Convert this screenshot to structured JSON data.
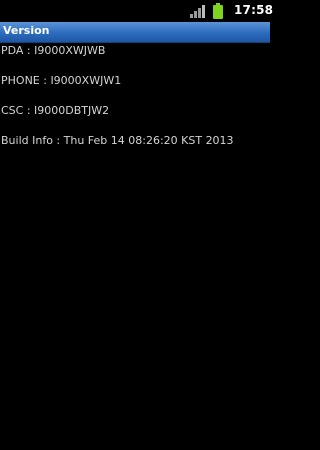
{
  "status_bar": {
    "time": "17:58",
    "signal_icon": "signal-strength-icon",
    "battery_icon": "battery-icon",
    "battery_color": "#7ed321"
  },
  "title_bar": {
    "title": "Version",
    "color": "#2d6bbd"
  },
  "version_info": {
    "pda": "PDA : I9000XWJWB",
    "phone": "PHONE : I9000XWJW1",
    "csc": "CSC : I9000DBTJW2",
    "build_info": "Build Info : Thu Feb 14 08:26:20 KST 2013"
  }
}
